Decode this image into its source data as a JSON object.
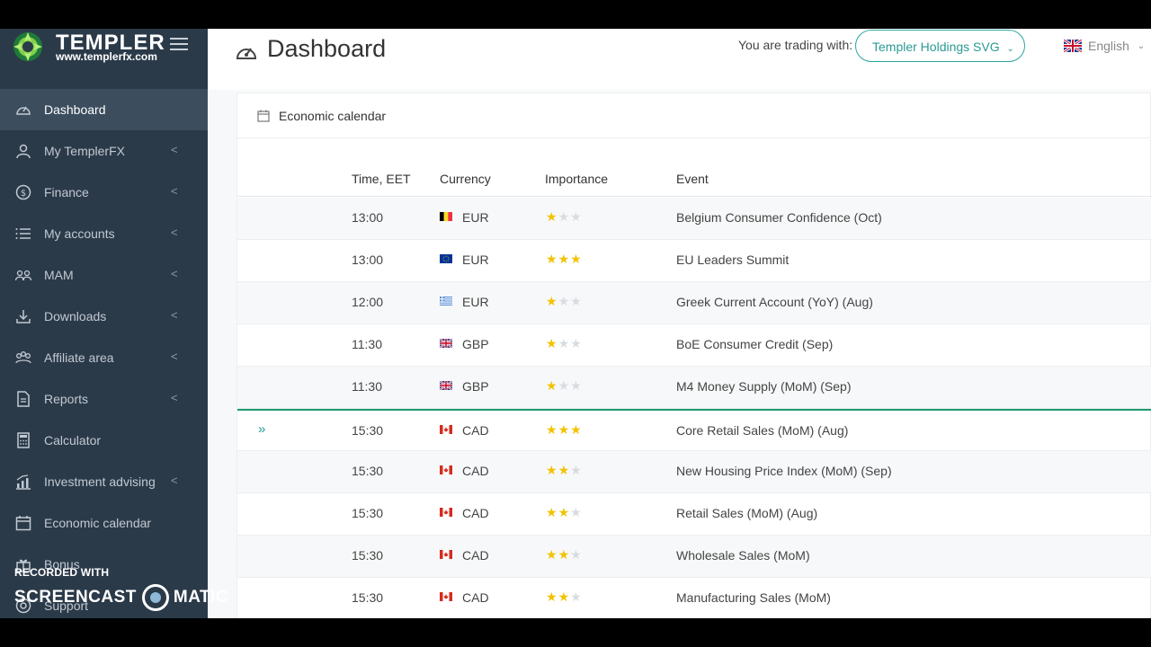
{
  "brand": {
    "name": "TEMPLER",
    "url": "www.templerfx.com"
  },
  "sidebar": {
    "items": [
      {
        "label": "Dashboard",
        "icon": "dashboard-icon",
        "arrow": ""
      },
      {
        "label": "My TemplerFX",
        "icon": "user-icon",
        "arrow": "<"
      },
      {
        "label": "Finance",
        "icon": "dollar-icon",
        "arrow": "<"
      },
      {
        "label": "My accounts",
        "icon": "list-icon",
        "arrow": "<"
      },
      {
        "label": "MAM",
        "icon": "group-icon",
        "arrow": "<"
      },
      {
        "label": "Downloads",
        "icon": "download-icon",
        "arrow": "<"
      },
      {
        "label": "Affiliate area",
        "icon": "affiliate-icon",
        "arrow": "<"
      },
      {
        "label": "Reports",
        "icon": "report-icon",
        "arrow": "<"
      },
      {
        "label": "Calculator",
        "icon": "calculator-icon",
        "arrow": ""
      },
      {
        "label": "Investment advising",
        "icon": "chart-icon",
        "arrow": "<"
      },
      {
        "label": "Economic calendar",
        "icon": "calendar-icon",
        "arrow": ""
      },
      {
        "label": "Bonus",
        "icon": "gift-icon",
        "arrow": ""
      },
      {
        "label": "Support",
        "icon": "support-icon",
        "arrow": ""
      }
    ]
  },
  "watermark": {
    "line1": "RECORDED WITH",
    "left": "SCREENCAST",
    "right": "MATIC"
  },
  "header": {
    "title": "Dashboard",
    "trading_label": "You are trading with:",
    "broker": "Templer Holdings SVG",
    "language": "English"
  },
  "calendar": {
    "title": "Economic calendar",
    "columns": {
      "time": "Time, EET",
      "currency": "Currency",
      "importance": "Importance",
      "event": "Event"
    },
    "rows": [
      {
        "time": "13:00",
        "flag": "belgium",
        "currency": "EUR",
        "stars": 1,
        "event": "Belgium Consumer Confidence (Oct)"
      },
      {
        "time": "13:00",
        "flag": "eu",
        "currency": "EUR",
        "stars": 3,
        "event": "EU Leaders Summit"
      },
      {
        "time": "12:00",
        "flag": "greece",
        "currency": "EUR",
        "stars": 1,
        "event": "Greek Current Account (YoY) (Aug)"
      },
      {
        "time": "11:30",
        "flag": "uk",
        "currency": "GBP",
        "stars": 1,
        "event": "BoE Consumer Credit (Sep)"
      },
      {
        "time": "11:30",
        "flag": "uk",
        "currency": "GBP",
        "stars": 1,
        "event": "M4 Money Supply (MoM) (Sep)"
      },
      {
        "time": "15:30",
        "flag": "canada",
        "currency": "CAD",
        "stars": 3,
        "event": "Core Retail Sales (MoM) (Aug)",
        "marker": "»"
      },
      {
        "time": "15:30",
        "flag": "canada",
        "currency": "CAD",
        "stars": 2,
        "event": "New Housing Price Index (MoM) (Sep)"
      },
      {
        "time": "15:30",
        "flag": "canada",
        "currency": "CAD",
        "stars": 2,
        "event": "Retail Sales (MoM) (Aug)"
      },
      {
        "time": "15:30",
        "flag": "canada",
        "currency": "CAD",
        "stars": 2,
        "event": "Wholesale Sales (MoM)"
      },
      {
        "time": "15:30",
        "flag": "canada",
        "currency": "CAD",
        "stars": 2,
        "event": "Manufacturing Sales (MoM)"
      }
    ]
  },
  "colors": {
    "sidebar_bg": "#2b3a49",
    "accent": "#2aa6a0",
    "star": "#f2c200",
    "now_line": "#1e9a6e"
  }
}
